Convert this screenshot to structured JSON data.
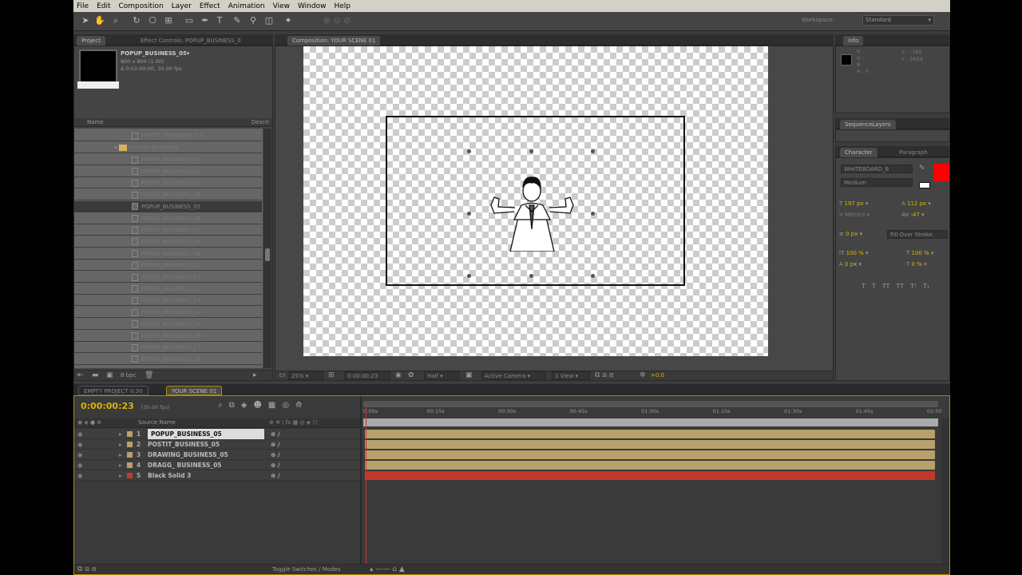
{
  "menu": [
    "File",
    "Edit",
    "Composition",
    "Layer",
    "Effect",
    "Animation",
    "View",
    "Window",
    "Help"
  ],
  "workspace": {
    "label": "Workspace:",
    "value": "Standard"
  },
  "project": {
    "tabs": [
      "Project",
      "Effect Controls: POPUP_BUSINESS_0"
    ],
    "item_name": "POPUP_BUSINESS_05▾",
    "item_dims": "800 x 800 (1.00)",
    "item_duration": "Δ 0:02:00:00, 30.00 fps",
    "col_name": "Name",
    "col_desc": "Descri",
    "bpc": "8 bpc",
    "folder": "PUP UP BUSINESS",
    "top_item": "POSTIT_BUSINESS_53",
    "items": [
      "POPUP_BUSINESS_01",
      "POPUP_BUSINESS_02",
      "POPUP_BUSINESS_03",
      "POPUP_BUSINESS_04",
      "POPUP_BUSINESS_05",
      "POPUP_BUSINESS_06",
      "POPUP_BUSINESS_07",
      "POPUP_BUSINESS_08",
      "POPUP_BUSINESS_09",
      "POPUP_BUSINESS_10",
      "POPUP_BUSINESS_11",
      "POPUP_BUSINESS_12",
      "POPUP_BUSINESS_13",
      "POPUP_BUSINESS_14",
      "POPUP_BUSINESS_15",
      "POPUP_BUSINESS_16",
      "POPUP_BUSINESS_17",
      "POPUP_BUSINESS_18"
    ]
  },
  "composition": {
    "tab": "Composition: YOUR SCENE 01",
    "zoom": "25%",
    "timecode": "0:00:00:23",
    "resolution": "Half",
    "camera": "Active Camera",
    "view": "1 View",
    "exposure": "+0.0"
  },
  "info": {
    "tab": "Info",
    "r": "R :",
    "g": "G :",
    "b": "B :",
    "a": "A : 0",
    "x": "X : -160",
    "y": "Y : 2624"
  },
  "sequencer": {
    "tab": "SequenceLayers"
  },
  "character": {
    "tabs": [
      "Character",
      "Paragraph"
    ],
    "font": "WHITEBOARD_B",
    "style": "Medium",
    "size": "197 px",
    "leading": "112 px",
    "kerning": "Metrics",
    "tracking": "-47",
    "stroke": "0 px",
    "stroke_mode": "Fill Over Stroke",
    "vscale": "100 %",
    "hscale": "100 %",
    "baseline": "0 px",
    "tsume": "0 %",
    "styles": [
      "T",
      "T",
      "TT",
      "TT",
      "T¹",
      "T₁"
    ]
  },
  "timeline": {
    "tabs": [
      "EMPTY PROJECT 0:30",
      "YOUR SCENE 01"
    ],
    "timecode": "0:00:00:23",
    "fps": "(30.00 fps)",
    "col_source": "Source Name",
    "ticks": [
      "0:00s",
      "00:15s",
      "00:30s",
      "00:45s",
      "01:00s",
      "01:15s",
      "01:30s",
      "01:45s",
      "02:00"
    ],
    "layers": [
      {
        "num": "1",
        "name": "POPUP_BUSINESS_05",
        "color": "#b8a16a"
      },
      {
        "num": "2",
        "name": "POSTIT_BUSINESS_05",
        "color": "#b8a16a"
      },
      {
        "num": "3",
        "name": "DRAWING_BUSINESS_05",
        "color": "#b8a16a"
      },
      {
        "num": "4",
        "name": "DRAGG_ BUSINESS_05",
        "color": "#b8a16a"
      },
      {
        "num": "5",
        "name": "Black Solid 3",
        "color": "#c0392b"
      }
    ],
    "toggle_label": "Toggle Switches / Modes"
  }
}
